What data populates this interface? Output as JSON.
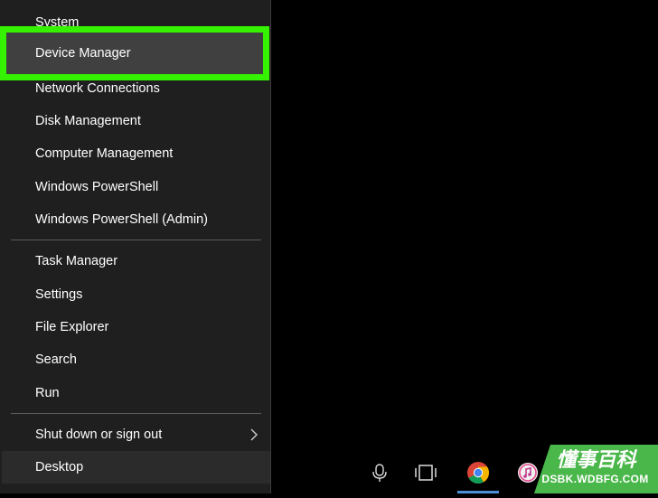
{
  "menu": {
    "items_top": [
      "System",
      "Device Manager",
      "Network Connections",
      "Disk Management",
      "Computer Management",
      "Windows PowerShell",
      "Windows PowerShell (Admin)"
    ],
    "items_mid": [
      "Task Manager",
      "Settings",
      "File Explorer",
      "Search",
      "Run"
    ],
    "shutdown_label": "Shut down or sign out",
    "desktop_label": "Desktop",
    "selected_item": "Device Manager",
    "highlight_color": "#35f200"
  },
  "taskbar": {
    "icons": [
      "microphone-icon",
      "task-view-icon",
      "chrome-icon",
      "itunes-icon"
    ]
  },
  "watermark": {
    "title": "懂事百科",
    "domain": "DSBK.WDBFG.COM"
  }
}
